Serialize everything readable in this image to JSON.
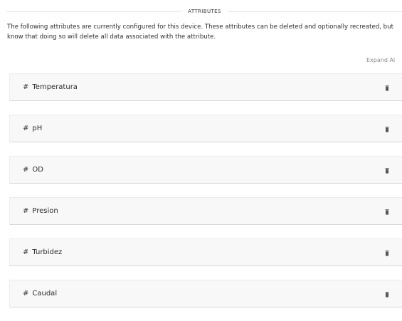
{
  "section": {
    "title": "ATTRIBUTES"
  },
  "intro": {
    "text": "The following attributes are currently configured for this device. These attributes can be deleted and optionally recreated, but know that doing so will delete all data associated with the attribute."
  },
  "toolbar": {
    "expand_all_label": "Expand Al"
  },
  "attributes": [
    {
      "prefix": "#",
      "name": "Temperatura",
      "icon": "trash-icon"
    },
    {
      "prefix": "#",
      "name": "pH",
      "icon": "trash-icon"
    },
    {
      "prefix": "#",
      "name": "OD",
      "icon": "trash-icon"
    },
    {
      "prefix": "#",
      "name": "Presion",
      "icon": "trash-icon"
    },
    {
      "prefix": "#",
      "name": "Turbidez",
      "icon": "trash-icon"
    },
    {
      "prefix": "#",
      "name": "Caudal",
      "icon": "trash-icon"
    }
  ],
  "colors": {
    "row_background": "#f8f8f8",
    "text": "#2b2b2b",
    "muted": "#8a8a8a"
  }
}
